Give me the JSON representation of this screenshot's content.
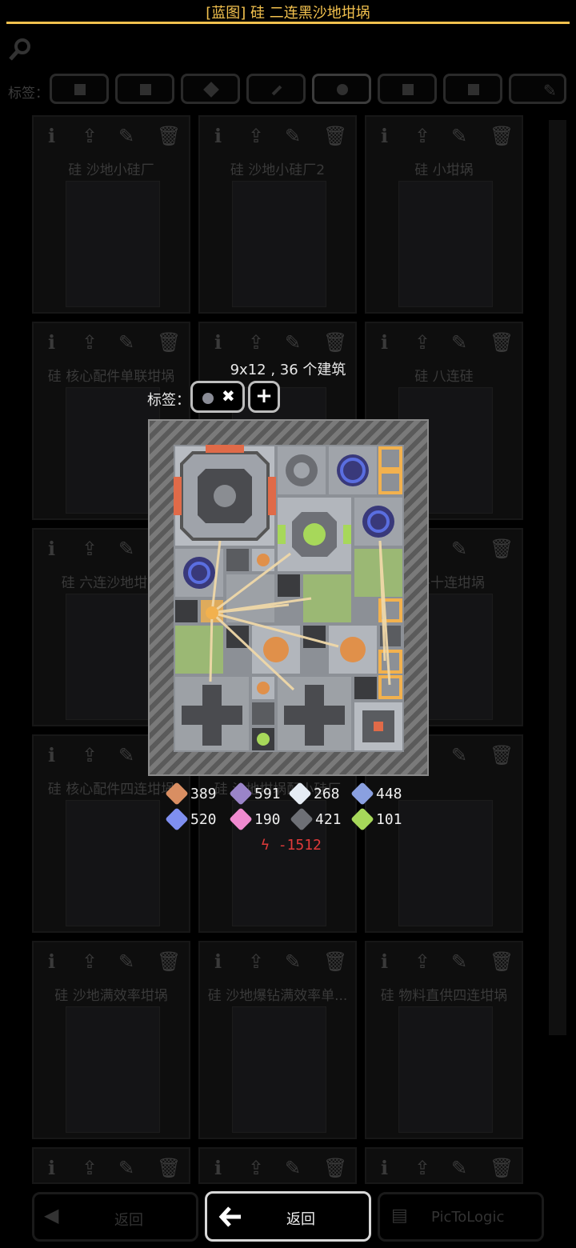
{
  "title": "[蓝图] 硅 二连黑沙地坩埚",
  "colors": {
    "accent": "#f2c14e",
    "power": "#e03a3a"
  },
  "background": {
    "search_icon": "search-icon",
    "tags_label": "标签：",
    "cards": [
      {
        "title": "硅  沙地小硅厂"
      },
      {
        "title": "硅  沙地小硅厂2"
      },
      {
        "title": "硅  小坩埚"
      },
      {
        "title": "硅  核心配件单联坩埚"
      },
      {
        "title": ""
      },
      {
        "title": "硅  八连硅"
      },
      {
        "title": "硅 六连沙地坩埚"
      },
      {
        "title": ""
      },
      {
        "title": "配件十连坩埚"
      },
      {
        "title": "硅 核心配件四连坩埚"
      },
      {
        "title": "硅 沙地坩埚配小硅厂"
      },
      {
        "title": ""
      },
      {
        "title": "硅 沙地满效率坩埚"
      },
      {
        "title": "硅 沙地爆钻满效率单..."
      },
      {
        "title": "硅 物料直供四连坩埚"
      }
    ],
    "bottom_left_label": "返回",
    "bottom_right_label": "PicToLogic"
  },
  "dialog": {
    "dimensions": "9x12 , 36 个建筑",
    "tags_label": "标签：",
    "tag_chip_icon": "silicon-icon",
    "remove_tag_glyph": "✖",
    "add_tag_glyph": "+",
    "costs": [
      {
        "item": "copper",
        "value": "389",
        "color": "#d98e62"
      },
      {
        "item": "lead",
        "value": "591",
        "color": "#9a84c8"
      },
      {
        "item": "metaglass",
        "value": "268",
        "color": "#e6ecf4"
      },
      {
        "item": "titanium",
        "value": "448",
        "color": "#8aa0e0"
      },
      {
        "item": "plastanium",
        "value": "520",
        "color": "#7f8ff0"
      },
      {
        "item": "phase-fabric",
        "value": "190",
        "color": "#f08ad0"
      },
      {
        "item": "silicon",
        "value": "421",
        "color": "#6e7076"
      },
      {
        "item": "surge-alloy",
        "value": "101",
        "color": "#a7d85a"
      }
    ],
    "power": "-1512",
    "back_label": "返回"
  }
}
